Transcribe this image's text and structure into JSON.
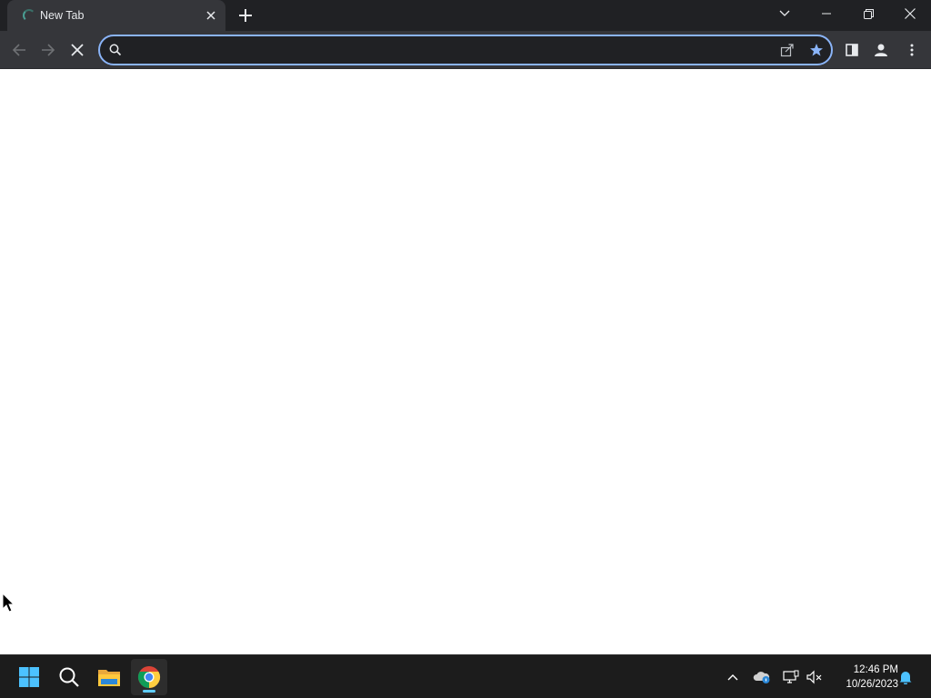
{
  "browser": {
    "tab": {
      "title": "New Tab",
      "loading": true
    },
    "omnibox": {
      "value": "",
      "placeholder": ""
    },
    "accent": "#8ab4f8",
    "icons": [
      "back-icon",
      "forward-icon",
      "stop-icon",
      "search-icon",
      "share-icon",
      "star-icon",
      "side-panel-icon",
      "profile-icon",
      "menu-icon"
    ]
  },
  "taskbar": {
    "apps": [
      "windows-start",
      "search",
      "file-explorer",
      "chrome"
    ],
    "active_app": "chrome",
    "clock": {
      "time": "12:46 PM",
      "date": "10/26/2023"
    }
  }
}
